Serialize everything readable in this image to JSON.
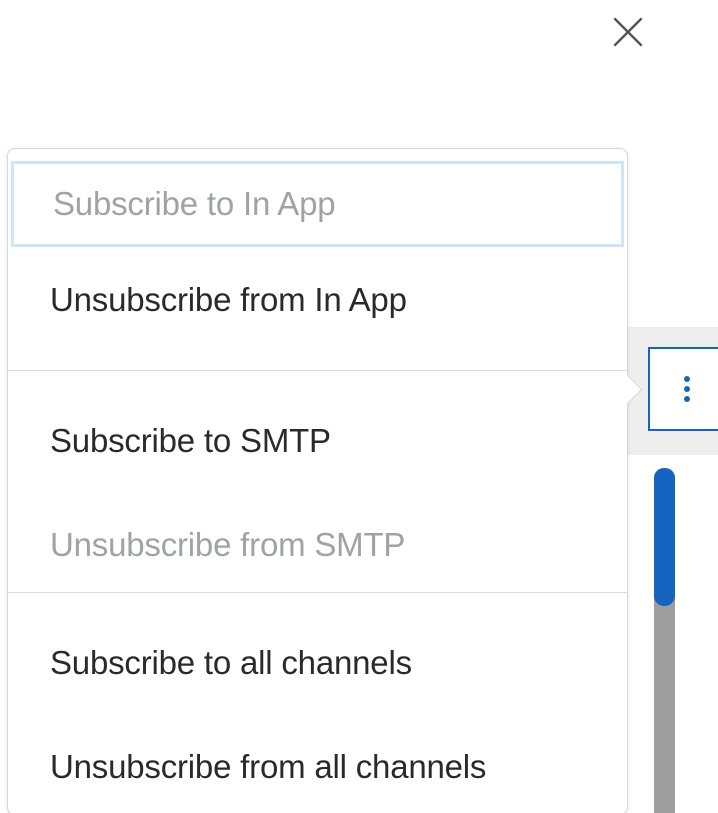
{
  "dialog": {
    "close_icon": "close-icon"
  },
  "actions_button": {
    "icon": "kebab-vertical-icon"
  },
  "menu": {
    "groups": [
      {
        "items": [
          {
            "label": "Subscribe to In App",
            "enabled": false,
            "focused": true
          },
          {
            "label": "Unsubscribe from In App",
            "enabled": true,
            "focused": false
          }
        ]
      },
      {
        "items": [
          {
            "label": "Subscribe to SMTP",
            "enabled": true,
            "focused": false
          },
          {
            "label": "Unsubscribe from SMTP",
            "enabled": false,
            "focused": false
          }
        ]
      },
      {
        "items": [
          {
            "label": "Subscribe to all channels",
            "enabled": true,
            "focused": false
          },
          {
            "label": "Unsubscribe from all channels",
            "enabled": true,
            "focused": false
          }
        ]
      }
    ]
  },
  "scrollbar": {
    "position_fraction": 0.0,
    "visible_fraction": 0.4
  },
  "colors": {
    "accent": "#1565c0",
    "text": "#2a2a2a",
    "disabled_text": "#9ea3a8",
    "focus_ring": "#cfe6f7",
    "divider": "#dcdcdc",
    "band": "#eeeeee",
    "track": "#9e9e9e"
  }
}
